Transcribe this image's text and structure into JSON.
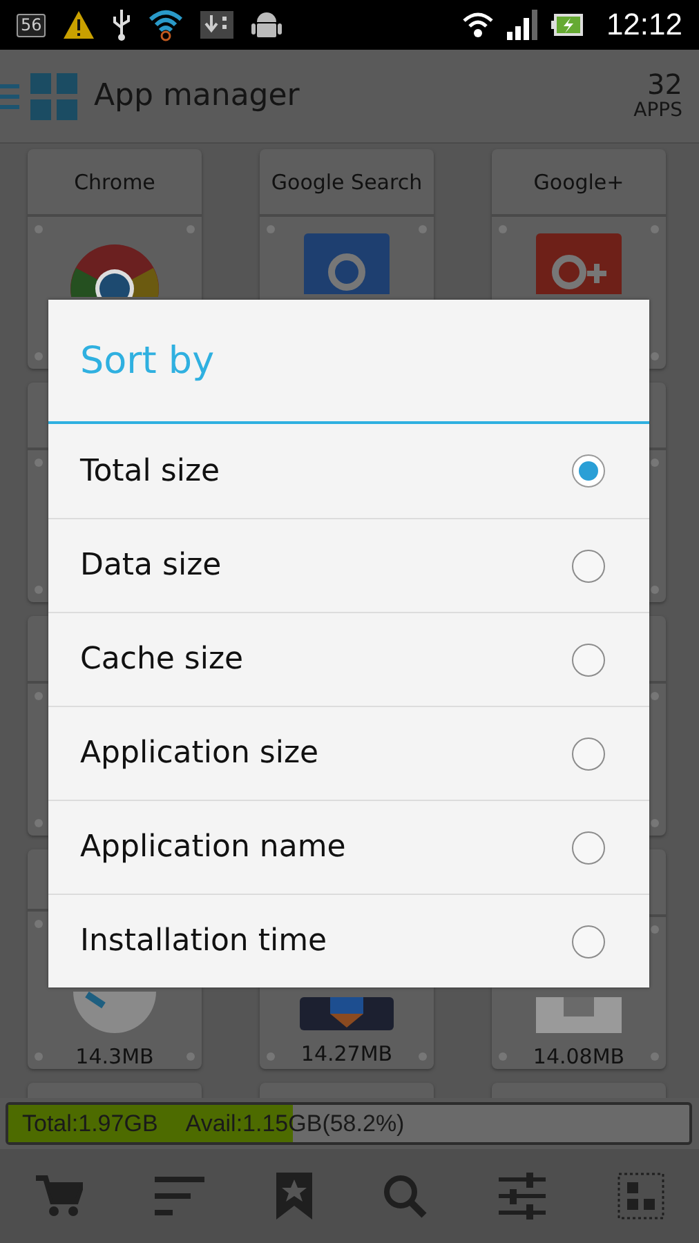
{
  "status_bar": {
    "badge": "56",
    "time": "12:12"
  },
  "header": {
    "title": "App manager",
    "count": "32",
    "count_label": "APPS"
  },
  "apps": [
    {
      "title": "Chrome"
    },
    {
      "title": "Google Search"
    },
    {
      "title": "Google+"
    }
  ],
  "sizes": [
    "14.3MB",
    "14.27MB",
    "14.08MB"
  ],
  "storage": {
    "total": "Total:1.97GB",
    "avail": "Avail:1.15GB(58.2%)",
    "level": 0.418
  },
  "dialog": {
    "title": "Sort by",
    "options": [
      {
        "label": "Total size",
        "selected": true
      },
      {
        "label": "Data size",
        "selected": false
      },
      {
        "label": "Cache size",
        "selected": false
      },
      {
        "label": "Application size",
        "selected": false
      },
      {
        "label": "Application name",
        "selected": false
      },
      {
        "label": "Installation time",
        "selected": false
      }
    ]
  }
}
